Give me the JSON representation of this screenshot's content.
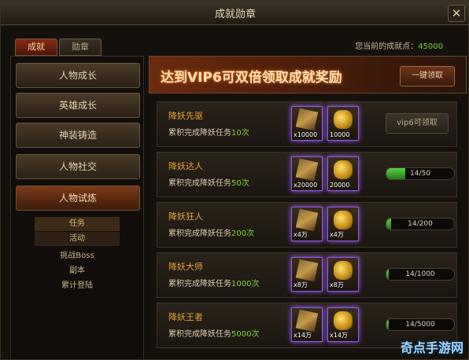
{
  "window": {
    "title": "成就勋章",
    "close_glyph": "✕"
  },
  "tabs": [
    {
      "label": "成就"
    },
    {
      "label": "勋章"
    }
  ],
  "score": {
    "label": "您当前的成就点：",
    "value": "45000"
  },
  "sidebar": {
    "items": [
      {
        "label": "人物成长"
      },
      {
        "label": "英雄成长"
      },
      {
        "label": "神装铸造"
      },
      {
        "label": "人物社交"
      },
      {
        "label": "人物试炼"
      }
    ],
    "sub_items": [
      {
        "label": "任务"
      },
      {
        "label": "活动"
      },
      {
        "label": "挑战Boss"
      },
      {
        "label": "副本"
      },
      {
        "label": "累计登陆"
      }
    ]
  },
  "banner": {
    "title": "达到VIP6可双倍领取成就奖励",
    "claim_all": "一键领取"
  },
  "achievements": [
    {
      "name": "降妖先驱",
      "desc_prefix": "累积完成降妖任务",
      "count": "10次",
      "reward1": "x10000",
      "reward2": "10000",
      "action": "vip6可领取"
    },
    {
      "name": "降妖达人",
      "desc_prefix": "累积完成降妖任务",
      "count": "50次",
      "reward1": "x20000",
      "reward2": "20000",
      "progress": "14/50",
      "progress_value": 0.28
    },
    {
      "name": "降妖狂人",
      "desc_prefix": "累积完成降妖任务",
      "count": "200次",
      "reward1": "x4万",
      "reward2": "x4万",
      "progress": "14/200",
      "progress_value": 0.07
    },
    {
      "name": "降妖大师",
      "desc_prefix": "累积完成降妖任务",
      "count": "1000次",
      "reward1": "x8万",
      "reward2": "x8万",
      "progress": "14/1000",
      "progress_value": 0.014
    },
    {
      "name": "降妖王者",
      "desc_prefix": "累积完成降妖任务",
      "count": "5000次",
      "reward1": "x14万",
      "reward2": "x14万",
      "progress": "14/5000",
      "progress_value": 0.0028
    }
  ],
  "watermark": "奇点手游网",
  "colors": {
    "accent_orange": "#e8a13a",
    "accent_green": "#7ed53a",
    "reward_glow": "#9d5cff"
  },
  "icons": {
    "reward1": "scroll-icon",
    "reward2": "gold-coins-icon",
    "close": "close-icon"
  }
}
